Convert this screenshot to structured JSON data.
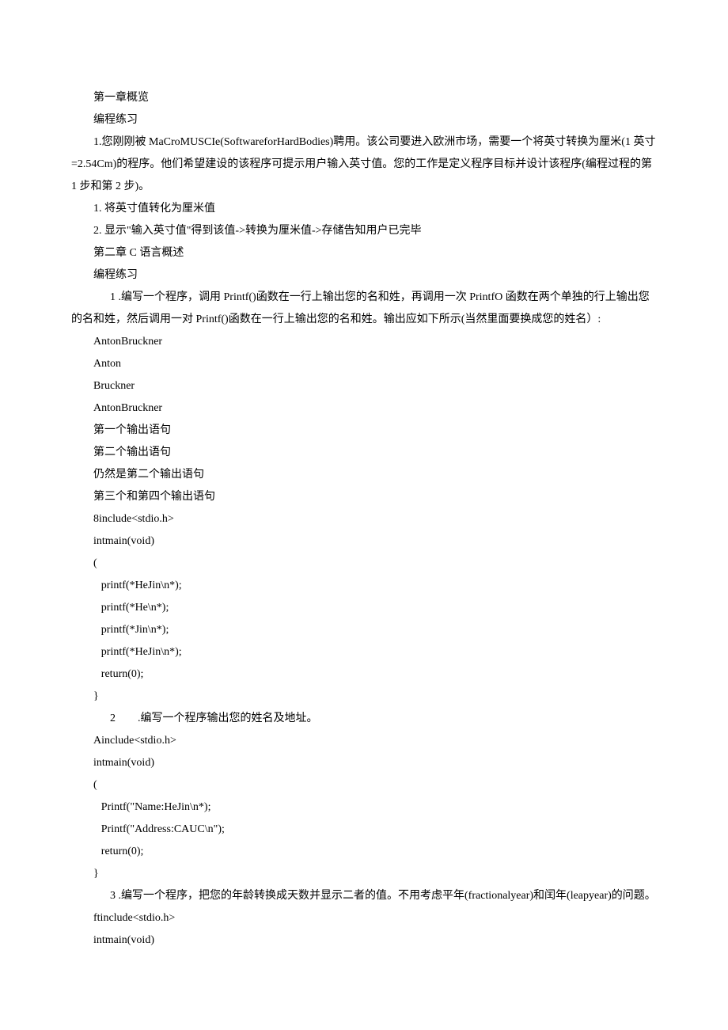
{
  "lines": [
    {
      "cls": "para",
      "text": "第一章概览"
    },
    {
      "cls": "para",
      "text": "编程练习"
    },
    {
      "cls": "para",
      "text": "1.您刚刚被 MaCroMUSCIe(SoftwareforHardBodies)聘用。该公司要进入欧洲市场，需要一个将英寸转换为厘米(1 英寸=2.54Cm)的程序。他们希望建设的该程序可提示用户输入英寸值。您的工作是定义程序目标并设计该程序(编程过程的第 1 步和第 2 步)。"
    },
    {
      "cls": "para",
      "text": "1. 将英寸值转化为厘米值"
    },
    {
      "cls": "para",
      "text": "2. 显示\"输入英寸值\"得到该值->转换为厘米值->存储告知用户已完毕"
    },
    {
      "cls": "para",
      "text": "第二章 C 语言概述"
    },
    {
      "cls": "para",
      "text": "编程练习"
    },
    {
      "cls": "numbered-wide",
      "text": "1 .编写一个程序，调用 Printf()函数在一行上输出您的名和姓，再调用一次 PrintfO 函数在两个单独的行上输出您的名和姓，然后调用一对 Printf()函数在一行上输出您的名和姓。输出应如下所示(当然里面要换成您的姓名）:"
    },
    {
      "cls": "code-line",
      "text": "AntonBruckner"
    },
    {
      "cls": "code-line",
      "text": "Anton"
    },
    {
      "cls": "code-line",
      "text": "Bruckner"
    },
    {
      "cls": "code-line",
      "text": "AntonBruckner"
    },
    {
      "cls": "code-line",
      "text": "第一个输出语句"
    },
    {
      "cls": "code-line",
      "text": "第二个输出语句"
    },
    {
      "cls": "code-line",
      "text": "仍然是第二个输出语句"
    },
    {
      "cls": "code-line",
      "text": "第三个和第四个输出语句"
    },
    {
      "cls": "code-line",
      "text": "8include<stdio.h>"
    },
    {
      "cls": "code-line",
      "text": "intmain(void)"
    },
    {
      "cls": "code-line",
      "text": "("
    },
    {
      "cls": "code-line-inner",
      "text": "printf(*HeJin\\n*);"
    },
    {
      "cls": "code-line-inner",
      "text": "printf(*He\\n*);"
    },
    {
      "cls": "code-line-inner",
      "text": "printf(*Jin\\n*);"
    },
    {
      "cls": "code-line-inner",
      "text": "printf(*HeJin\\n*);"
    },
    {
      "cls": "code-line-inner",
      "text": "return(0);"
    },
    {
      "cls": "code-line",
      "text": "}"
    },
    {
      "cls": "numbered-wide",
      "text": "2  .编写一个程序输出您的姓名及地址。"
    },
    {
      "cls": "code-line",
      "text": "Ainclude<stdio.h>"
    },
    {
      "cls": "code-line",
      "text": "intmain(void)"
    },
    {
      "cls": "code-line",
      "text": "("
    },
    {
      "cls": "code-line-inner",
      "text": "Printf(\"Name:HeJin\\n*);"
    },
    {
      "cls": "code-line-inner",
      "text": "Printf(\"Address:CAUC\\n\");"
    },
    {
      "cls": "code-line-inner",
      "text": "return(0);"
    },
    {
      "cls": "code-line",
      "text": "}"
    },
    {
      "cls": "numbered-wide",
      "text": "3 .编写一个程序，把您的年龄转换成天数并显示二者的值。不用考虑平年(fractionalyear)和闰年(leapyear)的问题。"
    },
    {
      "cls": "code-line",
      "text": "ftinclude<stdio.h>"
    },
    {
      "cls": "code-line",
      "text": "intmain(void)"
    }
  ]
}
